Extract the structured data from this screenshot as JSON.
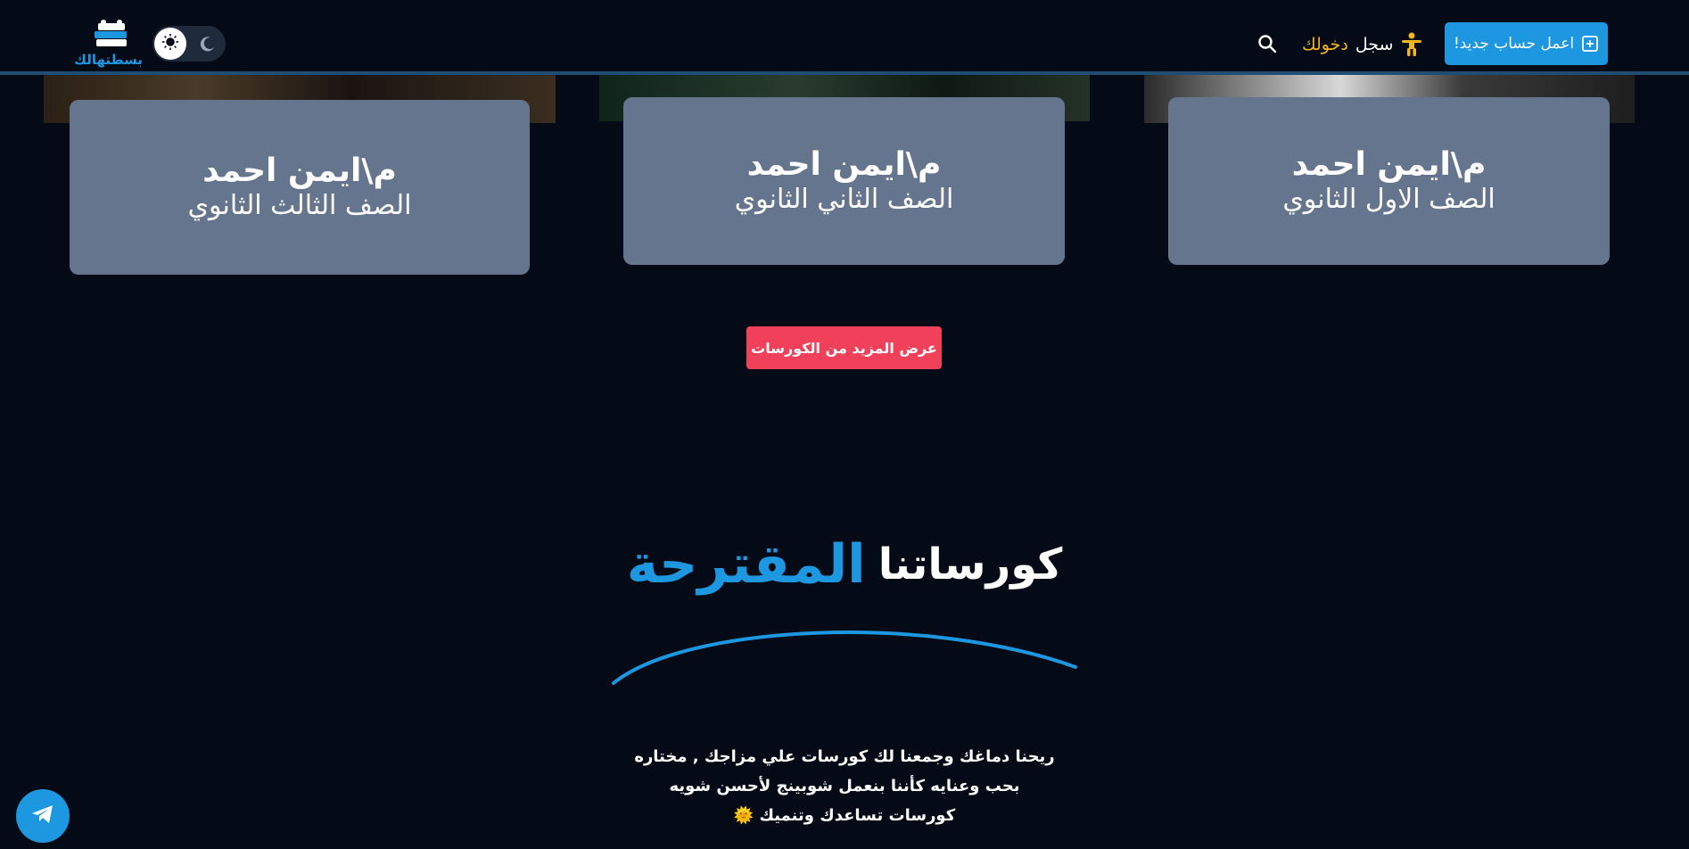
{
  "header": {
    "signup_label": "اعمل حساب جديد!",
    "login_white": "سجل",
    "login_gold": "دخولك",
    "logo_text": "بسطتهالك"
  },
  "courses": [
    {
      "teacher": "م\\ايمن احمد",
      "grade": "الصف الاول الثانوي"
    },
    {
      "teacher": "م\\ايمن احمد",
      "grade": "الصف الثاني الثانوي"
    },
    {
      "teacher": "م\\ايمن احمد",
      "grade": "الصف الثالث الثانوي"
    }
  ],
  "more_courses_label": "عرض المزيد من الكورسات",
  "suggested": {
    "title_white": "كورساتنا",
    "title_blue": "المقترحة",
    "desc_lines": [
      "ريحنا دماغك وجمعنا لك كورسات علي مزاجك , مختاره",
      "بحب وعنايه كأننا بنعمل شوبينج لأحسن شويه",
      "كورسات تساعدك وتنميك 🌞"
    ]
  },
  "colors": {
    "background": "#050b16",
    "accent_blue": "#1d97e0",
    "accent_gold": "#f5b51b",
    "card": "#66758e",
    "cta_red": "#f0405a"
  },
  "icons": {
    "signup": "plus-square-icon",
    "login": "accessibility-icon",
    "search": "search-icon",
    "theme_light": "sun-icon",
    "theme_dark": "moon-icon",
    "telegram": "telegram-icon"
  }
}
